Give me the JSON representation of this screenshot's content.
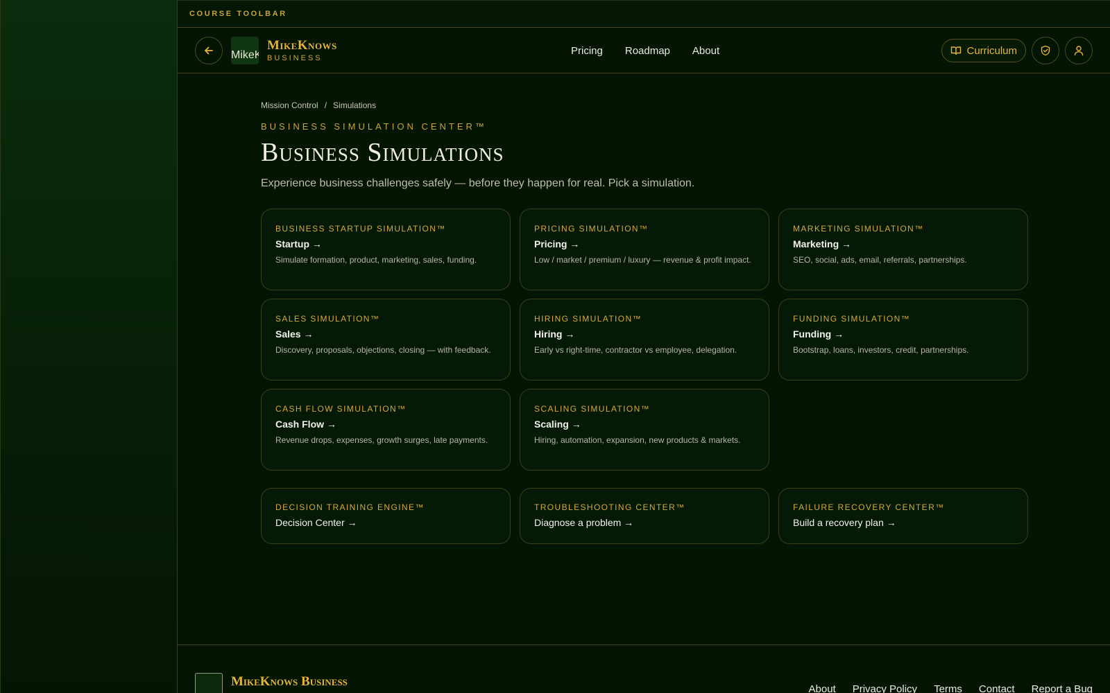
{
  "toolbar": {
    "label": "COURSE TOOLBAR"
  },
  "header": {
    "logo_alt": "MikeKnows",
    "brand_name": "MikeKnows",
    "brand_sub": "BUSINESS",
    "nav": [
      "Pricing",
      "Roadmap",
      "About"
    ],
    "curriculum_label": "Curriculum"
  },
  "breadcrumb": {
    "home": "Mission Control",
    "sep": "/",
    "current": "Simulations"
  },
  "page": {
    "eyebrow": "BUSINESS SIMULATION CENTER™",
    "title": "Business Simulations",
    "subtitle": "Experience business challenges safely — before they happen for real. Pick a simulation."
  },
  "simulations": [
    {
      "eyebrow": "BUSINESS STARTUP SIMULATION™",
      "title": "Startup →",
      "desc": "Simulate formation, product, marketing, sales, funding."
    },
    {
      "eyebrow": "PRICING SIMULATION™",
      "title": "Pricing →",
      "desc": "Low / market / premium / luxury — revenue & profit impact."
    },
    {
      "eyebrow": "MARKETING SIMULATION™",
      "title": "Marketing →",
      "desc": "SEO, social, ads, email, referrals, partnerships."
    },
    {
      "eyebrow": "SALES SIMULATION™",
      "title": "Sales →",
      "desc": "Discovery, proposals, objections, closing — with feedback."
    },
    {
      "eyebrow": "HIRING SIMULATION™",
      "title": "Hiring →",
      "desc": "Early vs right-time, contractor vs employee, delegation."
    },
    {
      "eyebrow": "FUNDING SIMULATION™",
      "title": "Funding →",
      "desc": "Bootstrap, loans, investors, credit, partnerships."
    },
    {
      "eyebrow": "CASH FLOW SIMULATION™",
      "title": "Cash Flow →",
      "desc": "Revenue drops, expenses, growth surges, late payments."
    },
    {
      "eyebrow": "SCALING SIMULATION™",
      "title": "Scaling →",
      "desc": "Hiring, automation, expansion, new products & markets."
    }
  ],
  "centers": [
    {
      "eyebrow": "DECISION TRAINING ENGINE™",
      "title": "Decision Center →"
    },
    {
      "eyebrow": "TROUBLESHOOTING CENTER™",
      "title": "Diagnose a problem →"
    },
    {
      "eyebrow": "FAILURE RECOVERY CENTER™",
      "title": "Build a recovery plan →"
    }
  ],
  "footer": {
    "brand": "MikeKnows Business",
    "links": [
      "About",
      "Privacy Policy",
      "Terms",
      "Contact",
      "Report a Bug"
    ]
  },
  "colors": {
    "accent": "#e6b53a",
    "background": "#041504",
    "border": "#3a3f17"
  }
}
